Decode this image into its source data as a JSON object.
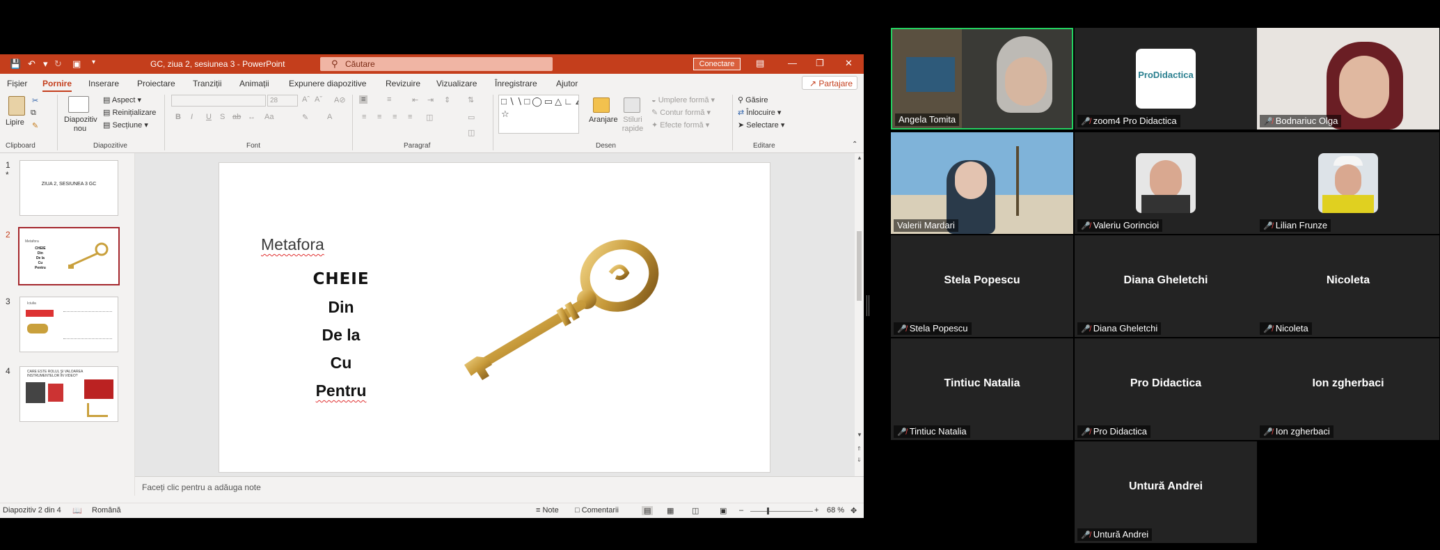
{
  "ppt": {
    "doc_title": "GC, ziua 2, sesiunea 3  -  PowerPoint",
    "search_placeholder": "Căutare",
    "connect_label": "Conectare",
    "share_label": "Partajare",
    "tabs": [
      "Fișier",
      "Pornire",
      "Inserare",
      "Proiectare",
      "Tranziții",
      "Animații",
      "Expunere diapozitive",
      "Revizuire",
      "Vizualizare",
      "Înregistrare",
      "Ajutor"
    ],
    "ribbon": {
      "clipboard": {
        "paste": "Lipire",
        "label": "Clipboard"
      },
      "slides": {
        "new_slide": "Diapozitiv nou",
        "layout": "Aspect",
        "reset": "Reinițializare",
        "section": "Secțiune",
        "label": "Diapozitive"
      },
      "font": {
        "size": "28",
        "label": "Font"
      },
      "paragraph": {
        "label": "Paragraf"
      },
      "drawing": {
        "arrange": "Aranjare",
        "quick_styles": "Stiluri rapide",
        "fill": "Umplere formă",
        "outline": "Contur formă",
        "effects": "Efecte formă",
        "label": "Desen"
      },
      "editing": {
        "find": "Găsire",
        "replace": "Înlocuire",
        "select": "Selectare",
        "label": "Editare"
      }
    },
    "slide_thumbs": [
      {
        "num": "1",
        "text": "ZIUA 2, SESIUNEA 3 GC"
      },
      {
        "num": "2",
        "text": "Metafora"
      },
      {
        "num": "3",
        "text": "Iciulia"
      },
      {
        "num": "4",
        "text": "CARE ESTE ROLUL ȘI VALOAREA INSTRUMENTELOR ÎN VIDEO?"
      }
    ],
    "current_slide": {
      "title": "Metafora",
      "words": [
        "CHEIE",
        "Din",
        "De la",
        "Cu",
        "Pentru"
      ]
    },
    "notes_placeholder": "Faceți clic pentru a adăuga note",
    "status": {
      "slide_info": "Diapozitiv 2 din 4",
      "language": "Română",
      "notes": "Note",
      "comments": "Comentarii",
      "zoom": "68 %"
    }
  },
  "gallery": [
    {
      "name": "Angela Tomita",
      "muted": false,
      "video": true,
      "active": true
    },
    {
      "name": "zoom4 Pro Didactica",
      "muted": true,
      "video": false,
      "logo": "ProDidactica"
    },
    {
      "name": "Bodnariuc Olga",
      "muted": true,
      "video": true
    },
    {
      "name": "Valerii Mardari",
      "muted": false,
      "video": true
    },
    {
      "name": "Valeriu Gorincioi",
      "muted": true,
      "video": false
    },
    {
      "name": "Lilian Frunze",
      "muted": true,
      "video": false
    },
    {
      "name": "Stela Popescu",
      "muted": true,
      "video": false,
      "center": "Stela Popescu"
    },
    {
      "name": "Diana Gheletchi",
      "muted": true,
      "video": false,
      "center": "Diana Gheletchi"
    },
    {
      "name": "Nicoleta",
      "muted": true,
      "video": false,
      "center": "Nicoleta"
    },
    {
      "name": "Tintiuc Natalia",
      "muted": true,
      "video": false,
      "center": "Tintiuc Natalia"
    },
    {
      "name": "Pro Didactica",
      "muted": true,
      "video": false,
      "center": "Pro Didactica"
    },
    {
      "name": "Ion zgherbaci",
      "muted": true,
      "video": false,
      "center": "Ion zgherbaci"
    },
    {
      "name": "Untură Andrei",
      "muted": true,
      "video": false,
      "center": "Untură Andrei"
    }
  ],
  "colors": {
    "ppt_accent": "#c43e1c",
    "active_speaker": "#23d160",
    "tile_bg": "#232323"
  }
}
